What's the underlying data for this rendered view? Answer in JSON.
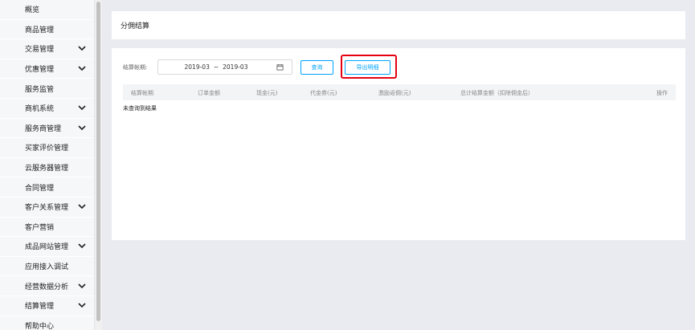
{
  "sidebar": {
    "items": [
      {
        "label": "概览",
        "expandable": false
      },
      {
        "label": "商品管理",
        "expandable": false
      },
      {
        "label": "交易管理",
        "expandable": true
      },
      {
        "label": "优惠管理",
        "expandable": true
      },
      {
        "label": "服务监管",
        "expandable": false
      },
      {
        "label": "商机系统",
        "expandable": true
      },
      {
        "label": "服务商管理",
        "expandable": true
      },
      {
        "label": "买家评价管理",
        "expandable": false
      },
      {
        "label": "云服务器管理",
        "expandable": false
      },
      {
        "label": "合同管理",
        "expandable": false
      },
      {
        "label": "客户关系管理",
        "expandable": true
      },
      {
        "label": "客户营销",
        "expandable": false
      },
      {
        "label": "成品网站管理",
        "expandable": true
      },
      {
        "label": "应用接入调试",
        "expandable": false
      },
      {
        "label": "经营数据分析",
        "expandable": true
      },
      {
        "label": "结算管理",
        "expandable": true
      },
      {
        "label": "帮助中心",
        "expandable": false
      }
    ]
  },
  "header": {
    "title": "分佣结算"
  },
  "filter": {
    "label": "结算帐期:",
    "start": "2019-03",
    "separator": "~",
    "end": "2019-03",
    "query_label": "查询",
    "export_label": "导出明细"
  },
  "table": {
    "columns": [
      "结算帐期",
      "订单金额",
      "现金(元)",
      "代金券(元)",
      "激励返佣(元)",
      "总计结算金额（扣除佣金后）",
      "操作"
    ],
    "empty_text": "未查询到结果"
  },
  "colors": {
    "accent": "#00a4ff",
    "highlight": "#e60012"
  }
}
